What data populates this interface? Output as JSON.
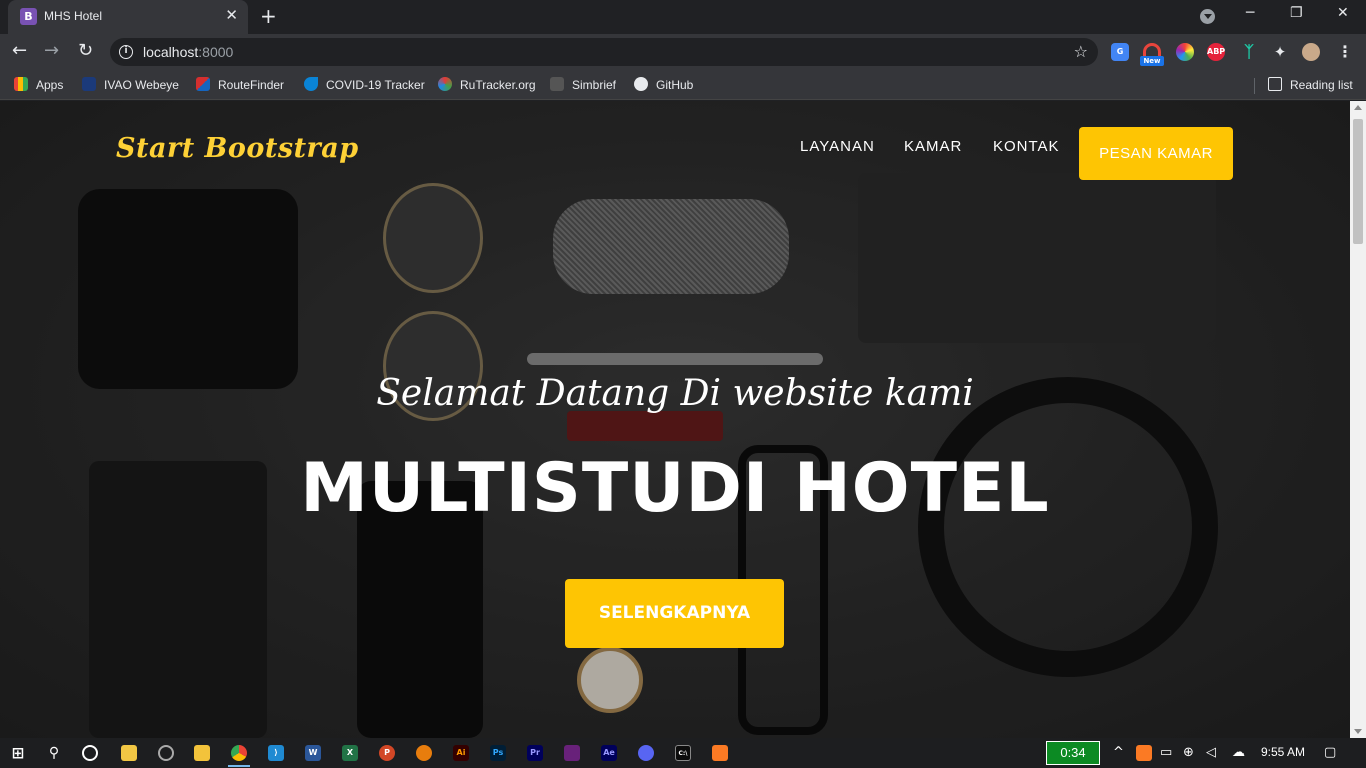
{
  "browser": {
    "tab_title": "MHS Hotel",
    "tab_favicon": "B",
    "url_host": "localhost",
    "url_port": ":8000",
    "reading_list": "Reading list",
    "bookmarks": [
      "Apps",
      "IVAO Webeye",
      "RouteFinder",
      "COVID-19 Tracker",
      "RuTracker.org",
      "Simbrief",
      "GitHub"
    ],
    "extensions": [
      "google-translate-icon",
      "rainbow-extension-icon",
      "color-wheel-icon",
      "adblock-plus-icon",
      "figure-icon",
      "puzzle-extensions-icon"
    ],
    "new_badge": "New",
    "abp_label": "ABP"
  },
  "site": {
    "brand": "Start Bootstrap",
    "nav": [
      "LAYANAN",
      "KAMAR",
      "KONTAK"
    ],
    "book_button": "PESAN KAMAR",
    "subheading": "Selamat Datang Di website kami",
    "heading": "MULTISTUDI HOTEL",
    "cta": "SELENGKAPNYA",
    "accent_color": "#fec503"
  },
  "taskbar": {
    "timer": "0:34",
    "clock": "9:55 AM",
    "apps": [
      "file-explorer",
      "chrome",
      "vscode",
      "word",
      "excel",
      "powerpoint",
      "blender",
      "illustrator",
      "photoshop",
      "premiere",
      "visual-studio",
      "after-effects",
      "discord",
      "terminal",
      "xampp"
    ]
  }
}
